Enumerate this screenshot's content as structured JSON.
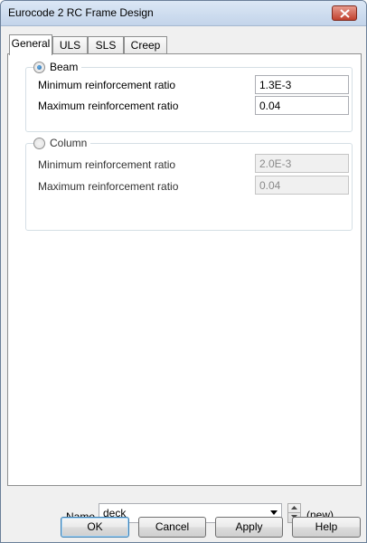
{
  "window": {
    "title": "Eurocode 2 RC Frame Design",
    "close_icon": "close-icon",
    "close_color": "#c1412d"
  },
  "tabs": [
    {
      "label": "General",
      "active": true
    },
    {
      "label": "ULS",
      "active": false
    },
    {
      "label": "SLS",
      "active": false
    },
    {
      "label": "Creep",
      "active": false
    }
  ],
  "beam": {
    "label": "Beam",
    "selected": true,
    "min_label": "Minimum reinforcement ratio",
    "min_value": "1.3E-3",
    "max_label": "Maximum reinforcement ratio",
    "max_value": "0.04"
  },
  "column": {
    "label": "Column",
    "selected": false,
    "min_label": "Minimum reinforcement ratio",
    "min_value": "2.0E-3",
    "max_label": "Maximum reinforcement ratio",
    "max_value": "0.04"
  },
  "footer": {
    "name_label": "Name",
    "name_value": "deck",
    "new_label": "(new)"
  },
  "buttons": {
    "ok": "OK",
    "cancel": "Cancel",
    "apply": "Apply",
    "help": "Help"
  }
}
